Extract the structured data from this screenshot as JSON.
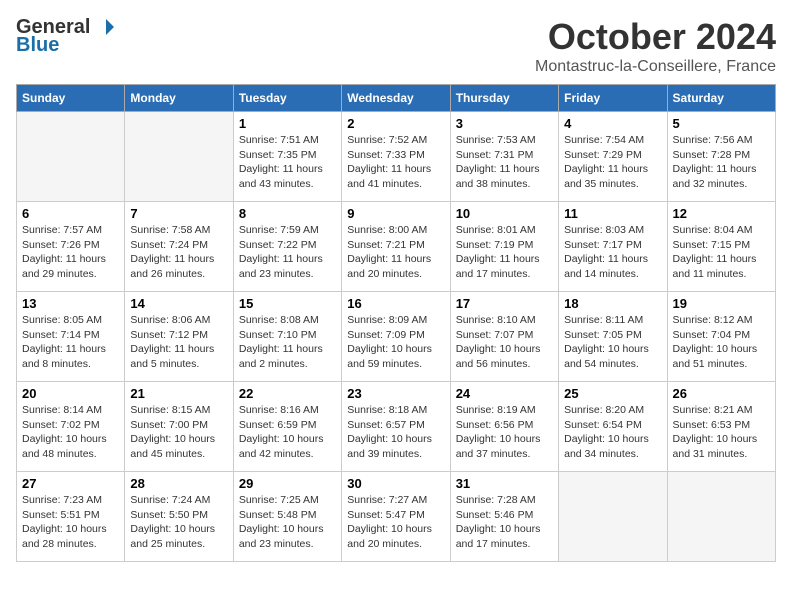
{
  "logo": {
    "general": "General",
    "blue": "Blue"
  },
  "title": "October 2024",
  "subtitle": "Montastruc-la-Conseillere, France",
  "days_header": [
    "Sunday",
    "Monday",
    "Tuesday",
    "Wednesday",
    "Thursday",
    "Friday",
    "Saturday"
  ],
  "weeks": [
    [
      {
        "day": "",
        "info": ""
      },
      {
        "day": "",
        "info": ""
      },
      {
        "day": "1",
        "info": "Sunrise: 7:51 AM\nSunset: 7:35 PM\nDaylight: 11 hours and 43 minutes."
      },
      {
        "day": "2",
        "info": "Sunrise: 7:52 AM\nSunset: 7:33 PM\nDaylight: 11 hours and 41 minutes."
      },
      {
        "day": "3",
        "info": "Sunrise: 7:53 AM\nSunset: 7:31 PM\nDaylight: 11 hours and 38 minutes."
      },
      {
        "day": "4",
        "info": "Sunrise: 7:54 AM\nSunset: 7:29 PM\nDaylight: 11 hours and 35 minutes."
      },
      {
        "day": "5",
        "info": "Sunrise: 7:56 AM\nSunset: 7:28 PM\nDaylight: 11 hours and 32 minutes."
      }
    ],
    [
      {
        "day": "6",
        "info": "Sunrise: 7:57 AM\nSunset: 7:26 PM\nDaylight: 11 hours and 29 minutes."
      },
      {
        "day": "7",
        "info": "Sunrise: 7:58 AM\nSunset: 7:24 PM\nDaylight: 11 hours and 26 minutes."
      },
      {
        "day": "8",
        "info": "Sunrise: 7:59 AM\nSunset: 7:22 PM\nDaylight: 11 hours and 23 minutes."
      },
      {
        "day": "9",
        "info": "Sunrise: 8:00 AM\nSunset: 7:21 PM\nDaylight: 11 hours and 20 minutes."
      },
      {
        "day": "10",
        "info": "Sunrise: 8:01 AM\nSunset: 7:19 PM\nDaylight: 11 hours and 17 minutes."
      },
      {
        "day": "11",
        "info": "Sunrise: 8:03 AM\nSunset: 7:17 PM\nDaylight: 11 hours and 14 minutes."
      },
      {
        "day": "12",
        "info": "Sunrise: 8:04 AM\nSunset: 7:15 PM\nDaylight: 11 hours and 11 minutes."
      }
    ],
    [
      {
        "day": "13",
        "info": "Sunrise: 8:05 AM\nSunset: 7:14 PM\nDaylight: 11 hours and 8 minutes."
      },
      {
        "day": "14",
        "info": "Sunrise: 8:06 AM\nSunset: 7:12 PM\nDaylight: 11 hours and 5 minutes."
      },
      {
        "day": "15",
        "info": "Sunrise: 8:08 AM\nSunset: 7:10 PM\nDaylight: 11 hours and 2 minutes."
      },
      {
        "day": "16",
        "info": "Sunrise: 8:09 AM\nSunset: 7:09 PM\nDaylight: 10 hours and 59 minutes."
      },
      {
        "day": "17",
        "info": "Sunrise: 8:10 AM\nSunset: 7:07 PM\nDaylight: 10 hours and 56 minutes."
      },
      {
        "day": "18",
        "info": "Sunrise: 8:11 AM\nSunset: 7:05 PM\nDaylight: 10 hours and 54 minutes."
      },
      {
        "day": "19",
        "info": "Sunrise: 8:12 AM\nSunset: 7:04 PM\nDaylight: 10 hours and 51 minutes."
      }
    ],
    [
      {
        "day": "20",
        "info": "Sunrise: 8:14 AM\nSunset: 7:02 PM\nDaylight: 10 hours and 48 minutes."
      },
      {
        "day": "21",
        "info": "Sunrise: 8:15 AM\nSunset: 7:00 PM\nDaylight: 10 hours and 45 minutes."
      },
      {
        "day": "22",
        "info": "Sunrise: 8:16 AM\nSunset: 6:59 PM\nDaylight: 10 hours and 42 minutes."
      },
      {
        "day": "23",
        "info": "Sunrise: 8:18 AM\nSunset: 6:57 PM\nDaylight: 10 hours and 39 minutes."
      },
      {
        "day": "24",
        "info": "Sunrise: 8:19 AM\nSunset: 6:56 PM\nDaylight: 10 hours and 37 minutes."
      },
      {
        "day": "25",
        "info": "Sunrise: 8:20 AM\nSunset: 6:54 PM\nDaylight: 10 hours and 34 minutes."
      },
      {
        "day": "26",
        "info": "Sunrise: 8:21 AM\nSunset: 6:53 PM\nDaylight: 10 hours and 31 minutes."
      }
    ],
    [
      {
        "day": "27",
        "info": "Sunrise: 7:23 AM\nSunset: 5:51 PM\nDaylight: 10 hours and 28 minutes."
      },
      {
        "day": "28",
        "info": "Sunrise: 7:24 AM\nSunset: 5:50 PM\nDaylight: 10 hours and 25 minutes."
      },
      {
        "day": "29",
        "info": "Sunrise: 7:25 AM\nSunset: 5:48 PM\nDaylight: 10 hours and 23 minutes."
      },
      {
        "day": "30",
        "info": "Sunrise: 7:27 AM\nSunset: 5:47 PM\nDaylight: 10 hours and 20 minutes."
      },
      {
        "day": "31",
        "info": "Sunrise: 7:28 AM\nSunset: 5:46 PM\nDaylight: 10 hours and 17 minutes."
      },
      {
        "day": "",
        "info": ""
      },
      {
        "day": "",
        "info": ""
      }
    ]
  ]
}
